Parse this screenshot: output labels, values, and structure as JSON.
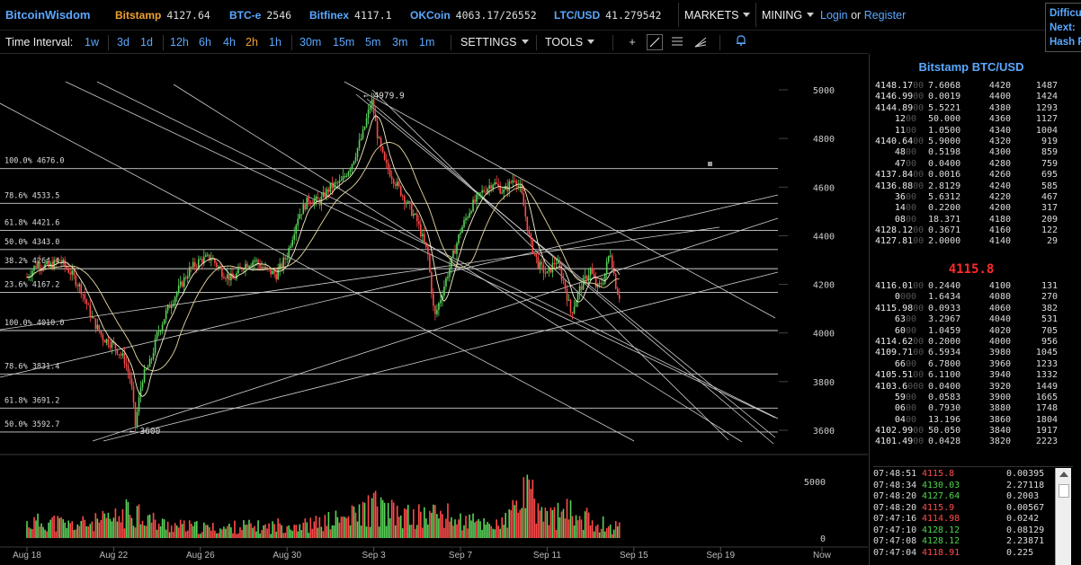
{
  "header": {
    "logo": "BitcoinWisdom",
    "tickers": [
      {
        "exchange": "Bitstamp",
        "price": "4127.64",
        "color": "orange"
      },
      {
        "exchange": "BTC-e",
        "price": "2546"
      },
      {
        "exchange": "Bitfinex",
        "price": "4117.1"
      },
      {
        "exchange": "OKCoin",
        "price": "4063.17/26552"
      },
      {
        "exchange": "LTC/USD",
        "price": "41.279542"
      }
    ],
    "markets_label": "MARKETS",
    "mining_label": "MINING",
    "login_label": "Login",
    "or_label": "or",
    "register_label": "Register",
    "difficulty_lines": [
      "Difficu",
      "Next:",
      "Hash R"
    ]
  },
  "toolbar": {
    "interval_label": "Time Interval:",
    "intervals": [
      "1w",
      "3d",
      "1d",
      "12h",
      "6h",
      "4h",
      "2h",
      "1h",
      "30m",
      "15m",
      "5m",
      "3m",
      "1m"
    ],
    "active_interval": "2h",
    "settings_label": "SETTINGS",
    "tools_label": "TOOLS",
    "tool_icons": [
      "crosshair-icon",
      "trendline-icon",
      "horizontal-lines-icon",
      "fan-icon",
      "alert-bell-icon"
    ]
  },
  "orderbook": {
    "title": "Bitstamp BTC/USD",
    "asks": [
      [
        "4148.17",
        "00",
        "7.6068",
        "4420",
        "1487"
      ],
      [
        "4146.99",
        "00",
        "0.0019",
        "4400",
        "1424"
      ],
      [
        "4144.89",
        "00",
        "5.5221",
        "4380",
        "1293"
      ],
      [
        "12",
        "00",
        "50.000",
        "4360",
        "1127"
      ],
      [
        "11",
        "00",
        "1.0500",
        "4340",
        "1004"
      ],
      [
        "4140.64",
        "00",
        "5.9000",
        "4320",
        "919"
      ],
      [
        "48",
        "00",
        "0.5198",
        "4300",
        "859"
      ],
      [
        "47",
        "00",
        "0.0400",
        "4280",
        "759"
      ],
      [
        "4137.84",
        "00",
        "0.0016",
        "4260",
        "695"
      ],
      [
        "4136.88",
        "00",
        "2.8129",
        "4240",
        "585"
      ],
      [
        "36",
        "00",
        "5.6312",
        "4220",
        "467"
      ],
      [
        "14",
        "00",
        "0.2200",
        "4200",
        "317"
      ],
      [
        "08",
        "00",
        "18.371",
        "4180",
        "209"
      ],
      [
        "4128.12",
        "00",
        "0.3671",
        "4160",
        "122"
      ],
      [
        "4127.81",
        "00",
        "2.0000",
        "4140",
        "29"
      ]
    ],
    "mid_price": "4115.8",
    "bids": [
      [
        "4116.01",
        "00",
        "0.2440",
        "4100",
        "131"
      ],
      [
        "0",
        "000",
        "1.6434",
        "4080",
        "270"
      ],
      [
        "4115.98",
        "00",
        "0.0933",
        "4060",
        "382"
      ],
      [
        "63",
        "00",
        "3.2967",
        "4040",
        "531"
      ],
      [
        "60",
        "00",
        "1.0459",
        "4020",
        "705"
      ],
      [
        "4114.62",
        "00",
        "0.2000",
        "4000",
        "956"
      ],
      [
        "4109.71",
        "00",
        "6.5934",
        "3980",
        "1045"
      ],
      [
        "66",
        "00",
        "6.7800",
        "3960",
        "1233"
      ],
      [
        "4105.51",
        "00",
        "6.1100",
        "3940",
        "1332"
      ],
      [
        "4103.6",
        "000",
        "0.0400",
        "3920",
        "1449"
      ],
      [
        "59",
        "00",
        "0.0583",
        "3900",
        "1665"
      ],
      [
        "06",
        "00",
        "0.7930",
        "3880",
        "1748"
      ],
      [
        "04",
        "00",
        "13.196",
        "3860",
        "1804"
      ],
      [
        "4102.99",
        "00",
        "50.050",
        "3840",
        "1917"
      ],
      [
        "4101.49",
        "00",
        "0.0428",
        "3820",
        "2223"
      ]
    ]
  },
  "trades": [
    {
      "time": "07:48:51",
      "price": "4115.8",
      "dir": "dn",
      "amount": "0.00395"
    },
    {
      "time": "07:48:34",
      "price": "4130.03",
      "dir": "up",
      "amount": "2.27118"
    },
    {
      "time": "07:48:20",
      "price": "4127.64",
      "dir": "up",
      "amount": "0.2003"
    },
    {
      "time": "07:48:20",
      "price": "4115.9",
      "dir": "dn",
      "amount": "0.00567"
    },
    {
      "time": "07:47:16",
      "price": "4114.98",
      "dir": "dn",
      "amount": "0.0242"
    },
    {
      "time": "07:47:10",
      "price": "4128.12",
      "dir": "up",
      "amount": "0.08129"
    },
    {
      "time": "07:47:08",
      "price": "4128.12",
      "dir": "up",
      "amount": "2.23871"
    },
    {
      "time": "07:47:04",
      "price": "4118.91",
      "dir": "dn",
      "amount": "0.225"
    }
  ],
  "chart_data": {
    "type": "candlestick",
    "price_axis_ticks": [
      5000,
      4800,
      4600,
      4400,
      4200,
      4000,
      3800,
      3600
    ],
    "volume_axis_ticks": [
      5000,
      0
    ],
    "x_tick_labels": [
      "Aug 18",
      "Aug 22",
      "Aug 26",
      "Aug 30",
      "Sep 3",
      "Sep 7",
      "Sep 11",
      "Sep 15",
      "Sep 19",
      "Now"
    ],
    "high_annotation": "4979.9",
    "low_annotation": "3600",
    "fib_levels": [
      {
        "label": "100.0% 4676.0",
        "price": 4676.0
      },
      {
        "label": "78.6% 4533.5",
        "price": 4533.5
      },
      {
        "label": "61.8% 4421.6",
        "price": 4421.6
      },
      {
        "label": "50.0% 4343.0",
        "price": 4343.0
      },
      {
        "label": "38.2% 4264.4",
        "price": 4264.4
      },
      {
        "label": "23.6% 4167.2",
        "price": 4167.2
      },
      {
        "label": "100.0% 4010.0",
        "price": 4010.0
      },
      {
        "label": "78.6% 3831.4",
        "price": 3831.4
      },
      {
        "label": "61.8% 3691.2",
        "price": 3691.2
      },
      {
        "label": "50.0% 3592.7",
        "price": 3592.7
      }
    ],
    "price_path": [
      [
        0,
        4230
      ],
      [
        0.5,
        4290
      ],
      [
        1,
        4270
      ],
      [
        1.5,
        4300
      ],
      [
        2,
        4250
      ],
      [
        2.5,
        4180
      ],
      [
        3,
        4060
      ],
      [
        3.5,
        3980
      ],
      [
        4,
        3950
      ],
      [
        4.5,
        3890
      ],
      [
        4.8,
        3800
      ],
      [
        5.0,
        3620
      ],
      [
        5.3,
        3810
      ],
      [
        5.7,
        3880
      ],
      [
        6,
        3990
      ],
      [
        6.5,
        4100
      ],
      [
        7,
        4180
      ],
      [
        7.5,
        4260
      ],
      [
        8,
        4300
      ],
      [
        8.5,
        4310
      ],
      [
        9,
        4250
      ],
      [
        9.5,
        4220
      ],
      [
        10,
        4280
      ],
      [
        10.5,
        4300
      ],
      [
        11,
        4260
      ],
      [
        11.5,
        4240
      ],
      [
        12,
        4320
      ],
      [
        12.5,
        4480
      ],
      [
        13,
        4550
      ],
      [
        13.5,
        4540
      ],
      [
        14,
        4600
      ],
      [
        14.5,
        4620
      ],
      [
        15,
        4700
      ],
      [
        15.5,
        4820
      ],
      [
        15.9,
        4960
      ],
      [
        16.2,
        4800
      ],
      [
        16.5,
        4700
      ],
      [
        17,
        4620
      ],
      [
        17.5,
        4540
      ],
      [
        18,
        4460
      ],
      [
        18.5,
        4320
      ],
      [
        18.8,
        4060
      ],
      [
        19.2,
        4180
      ],
      [
        19.6,
        4300
      ],
      [
        20,
        4420
      ],
      [
        20.5,
        4520
      ],
      [
        21,
        4580
      ],
      [
        21.5,
        4620
      ],
      [
        22,
        4580
      ],
      [
        22.5,
        4640
      ],
      [
        22.8,
        4580
      ],
      [
        23.2,
        4380
      ],
      [
        23.6,
        4280
      ],
      [
        24,
        4240
      ],
      [
        24.4,
        4300
      ],
      [
        24.8,
        4200
      ],
      [
        25.1,
        4080
      ],
      [
        25.5,
        4180
      ],
      [
        26,
        4260
      ],
      [
        26.3,
        4180
      ],
      [
        26.6,
        4220
      ],
      [
        26.9,
        4340
      ],
      [
        27.2,
        4180
      ],
      [
        27.4,
        4140
      ]
    ],
    "volume_profile": [
      [
        0,
        1800
      ],
      [
        1,
        2100
      ],
      [
        2,
        1600
      ],
      [
        3,
        1900
      ],
      [
        4,
        2300
      ],
      [
        5,
        3600
      ],
      [
        6,
        1800
      ],
      [
        7,
        1500
      ],
      [
        8,
        1300
      ],
      [
        9,
        1200
      ],
      [
        10,
        1500
      ],
      [
        11,
        1300
      ],
      [
        12,
        1800
      ],
      [
        13,
        1600
      ],
      [
        14,
        2100
      ],
      [
        15,
        2600
      ],
      [
        16,
        3900
      ],
      [
        17,
        2800
      ],
      [
        18,
        2600
      ],
      [
        19,
        3100
      ],
      [
        20,
        2100
      ],
      [
        21,
        1900
      ],
      [
        22,
        1700
      ],
      [
        23,
        5600
      ],
      [
        24,
        2600
      ],
      [
        25,
        3100
      ],
      [
        26,
        2200
      ],
      [
        27,
        1400
      ]
    ]
  }
}
